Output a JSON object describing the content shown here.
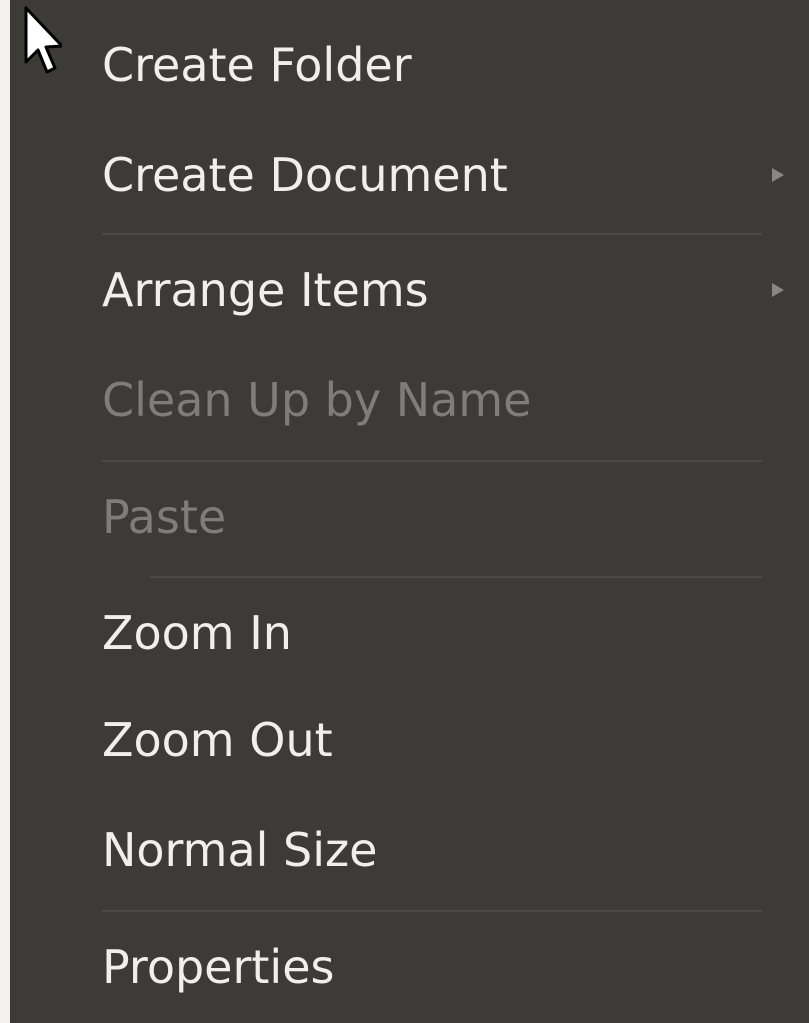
{
  "context_menu": {
    "items": [
      {
        "label": "Create Folder",
        "enabled": true,
        "submenu": false
      },
      {
        "label": "Create Document",
        "enabled": true,
        "submenu": true
      },
      {
        "label": "Arrange Items",
        "enabled": true,
        "submenu": true
      },
      {
        "label": "Clean Up by Name",
        "enabled": false,
        "submenu": false
      },
      {
        "label": "Paste",
        "enabled": false,
        "submenu": false
      },
      {
        "label": "Zoom In",
        "enabled": true,
        "submenu": false
      },
      {
        "label": "Zoom Out",
        "enabled": true,
        "submenu": false
      },
      {
        "label": "Normal Size",
        "enabled": true,
        "submenu": false
      },
      {
        "label": "Properties",
        "enabled": true,
        "submenu": false
      }
    ]
  },
  "colors": {
    "menu_background": "#3c3b37",
    "text_enabled": "#f2efea",
    "text_disabled": "#807d78",
    "separator": "#4a4944",
    "edge": "#f2f1f0"
  },
  "icons": {
    "cursor": "mouse-pointer-icon",
    "submenu": "submenu-arrow-icon"
  }
}
